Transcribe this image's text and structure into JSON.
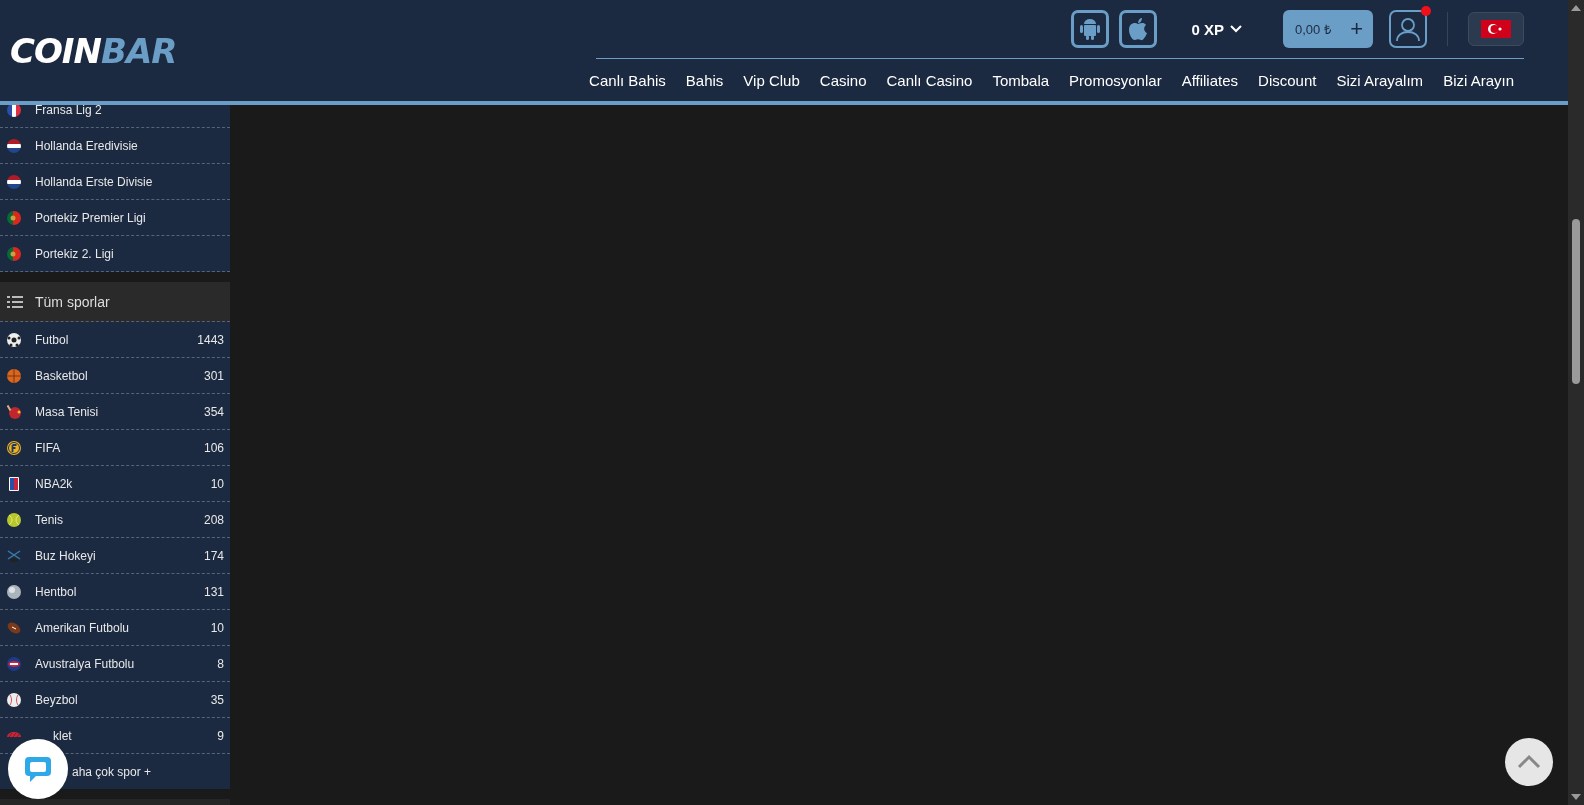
{
  "header": {
    "logo": {
      "part_1": "COIN",
      "part_2": "BAR"
    },
    "xp": "0 XP",
    "balance": "0,00 ₺",
    "balance_add": "+",
    "user_notification": true,
    "nav": [
      "Canlı Bahis",
      "Bahis",
      "Vip Club",
      "Casino",
      "Canlı Casino",
      "Tombala",
      "Promosyonlar",
      "Affiliates",
      "Discount",
      "Sizi Arayalım",
      "Bizi Arayın"
    ]
  },
  "leagues": [
    {
      "name": "Fransa Lig 2",
      "kind": "fr"
    },
    {
      "name": "Hollanda Eredivisie",
      "kind": "nl"
    },
    {
      "name": "Hollanda Erste Divisie",
      "kind": "nl"
    },
    {
      "name": "Portekiz Premier Ligi",
      "kind": "pt"
    },
    {
      "name": "Portekiz 2. Ligi",
      "kind": "pt"
    }
  ],
  "sports_title": "Tüm sporlar",
  "sports": [
    {
      "name": "Futbol",
      "count": "1443",
      "kind": "soccer"
    },
    {
      "name": "Basketbol",
      "count": "301",
      "kind": "basket"
    },
    {
      "name": "Masa Tenisi",
      "count": "354",
      "kind": "pingpong"
    },
    {
      "name": "FIFA",
      "count": "106",
      "kind": "fifa"
    },
    {
      "name": "NBA2k",
      "count": "10",
      "kind": "nba"
    },
    {
      "name": "Tenis",
      "count": "208",
      "kind": "tennis"
    },
    {
      "name": "Buz Hokeyi",
      "count": "174",
      "kind": "hockey"
    },
    {
      "name": "Hentbol",
      "count": "131",
      "kind": "handball"
    },
    {
      "name": "Amerikan Futbolu",
      "count": "10",
      "kind": "football"
    },
    {
      "name": "Avustralya Futbolu",
      "count": "8",
      "kind": "afl"
    },
    {
      "name": "Beyzbol",
      "count": "35",
      "kind": "baseball"
    },
    {
      "name": "klet",
      "count": "9",
      "kind": "cycling"
    }
  ],
  "more_sports": "aha çok spor +"
}
